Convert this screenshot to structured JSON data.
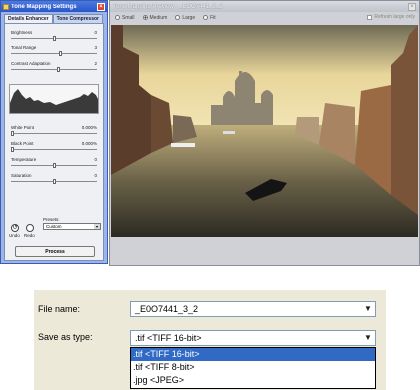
{
  "settings": {
    "title": "Tone Mapping Settings",
    "tabs": [
      "Details Enhancer",
      "Tone Compressor"
    ],
    "sliders": [
      {
        "label": "Brightness",
        "value": "0"
      },
      {
        "label": "Tonal Range",
        "value": "3"
      },
      {
        "label": "Contrast Adaptation",
        "value": "2"
      },
      {
        "label": "White Point",
        "value": "0.000%"
      },
      {
        "label": "Black Point",
        "value": "0.000%"
      },
      {
        "label": "Temperature",
        "value": "0"
      },
      {
        "label": "Saturation",
        "value": "0"
      }
    ],
    "undo": "Undo",
    "redo": "Redo",
    "presets_label": "Presets:",
    "presets_value": "Custom",
    "process": "Process"
  },
  "preview": {
    "title": "Tone Mapping Preview - _EOO7441_3_2",
    "sizes": [
      "Small",
      "Medium",
      "Large",
      "Fit"
    ],
    "selected_size": "Medium",
    "refresh_label": "Refresh large only"
  },
  "save_dialog": {
    "file_name_label": "File name:",
    "file_name_value": "_E0O7441_3_2",
    "type_label": "Save as type:",
    "type_value": ".tif <TIFF 16-bit>",
    "options": [
      ".tif <TIFF 16-bit>",
      ".tif <TIFF 8-bit>",
      ".jpg <JPEG>"
    ],
    "selected_option": 0
  },
  "icons": {
    "undo": "undo-icon",
    "redo": "redo-icon",
    "close": "close-icon",
    "dropdown": "chevron-down-icon"
  },
  "colors": {
    "titlebar": "#2a55c8",
    "selection": "#316ac5",
    "dialog_bg": "#ece9d8"
  }
}
